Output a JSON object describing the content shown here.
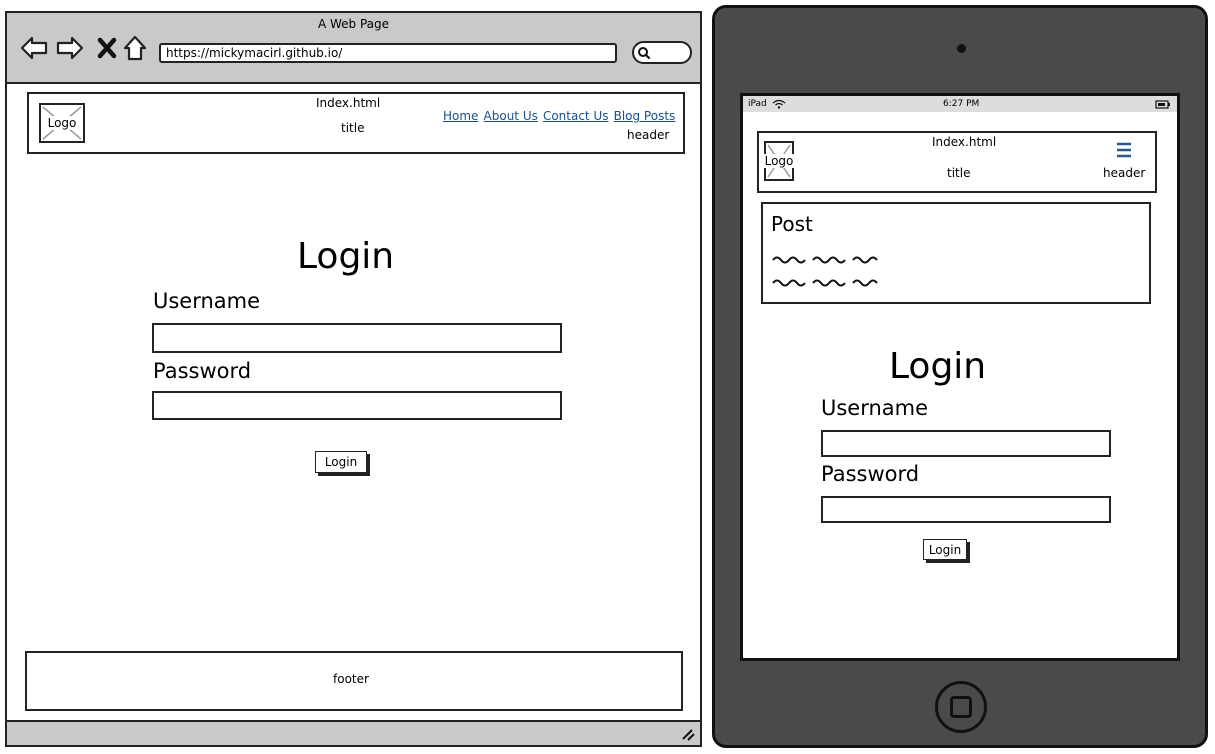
{
  "browser": {
    "window_title": "A Web Page",
    "url": "https://mickymacirl.github.io/",
    "header": {
      "logo_label": "Logo",
      "page_file": "Index.html",
      "title": "title",
      "caption": "header",
      "nav_links": [
        "Home",
        "About Us",
        "Contact Us",
        "Blog Posts"
      ]
    },
    "login": {
      "heading": "Login",
      "username_label": "Username",
      "password_label": "Password",
      "button_label": "Login"
    },
    "footer": {
      "caption": "footer"
    }
  },
  "tablet": {
    "status": {
      "device": "iPad",
      "time": "6:27 PM"
    },
    "header": {
      "logo_label": "Logo",
      "page_file": "Index.html",
      "title": "title",
      "caption": "header"
    },
    "post": {
      "title": "Post"
    },
    "login": {
      "heading": "Login",
      "username_label": "Username",
      "password_label": "Password",
      "button_label": "Login"
    }
  },
  "icons": {
    "back": "arrow-left-icon",
    "forward": "arrow-right-icon",
    "stop": "close-icon",
    "home": "home-icon",
    "search": "search-icon",
    "resize": "resize-grip-icon",
    "wifi": "wifi-icon",
    "battery": "battery-icon",
    "menu": "hamburger-menu-icon"
  },
  "colors": {
    "chrome_gray": "#c9c9c9",
    "tablet_body": "#4a4a4a",
    "link_blue": "#1a4f8a"
  }
}
